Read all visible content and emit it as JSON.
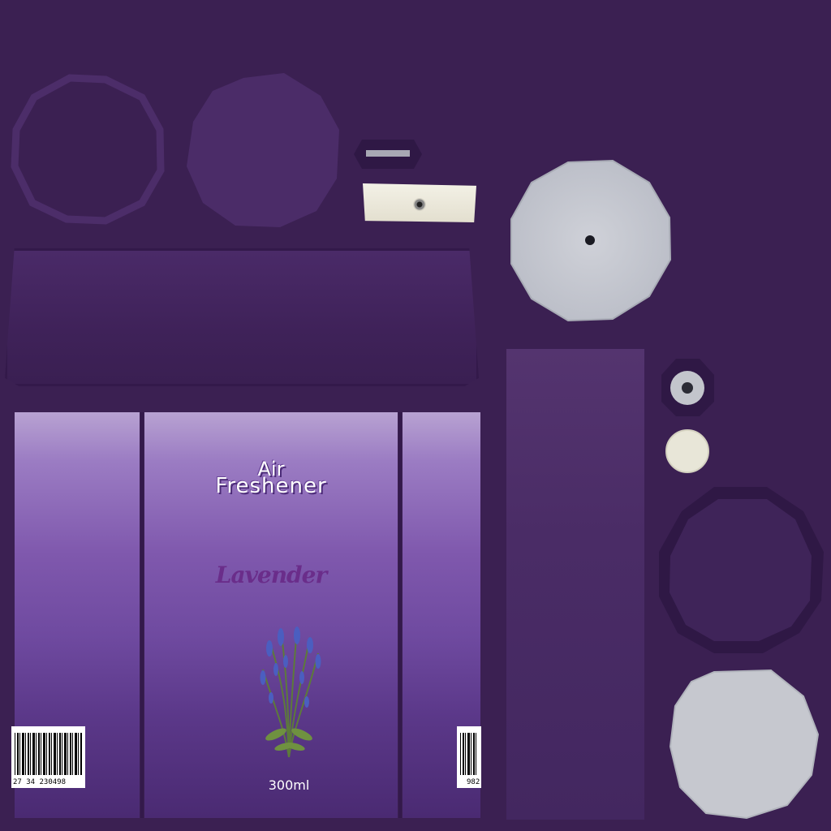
{
  "label": {
    "title_line1": "Air",
    "title_line2": "Freshener",
    "flavor": "Lavender",
    "volume": "300ml",
    "barcode_left_number": "27 34 230498",
    "barcode_right_number": "982"
  },
  "colors": {
    "background": "#3b2052",
    "label_top": "#b8a2d2",
    "label_bottom": "#4a2a72",
    "cap_grey": "#c9cbd2",
    "flavor_text": "#6a2d8a",
    "title_text": "#ffffff"
  },
  "icons": {
    "lavender_illustration": "lavender-sprig-icon",
    "barcode": "barcode-icon"
  }
}
